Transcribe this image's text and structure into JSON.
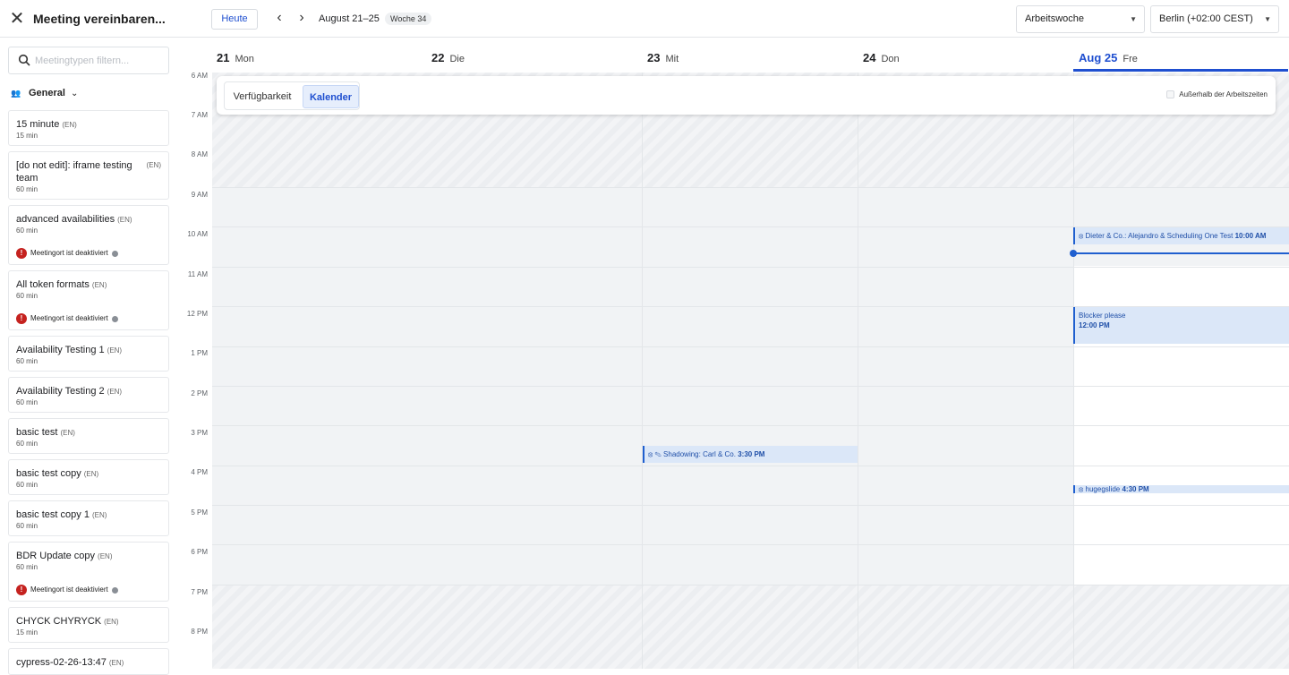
{
  "header": {
    "title": "Meeting vereinbaren...",
    "today_label": "Heute",
    "range_label": "August 21–25",
    "week_badge": "Woche 34",
    "view_select": "Arbeitswoche",
    "timezone_select": "Berlin (+02:00 CEST)"
  },
  "sidebar": {
    "search_placeholder": "Meetingtypen filtern...",
    "group_label": "General",
    "items": [
      {
        "name": "15 minute",
        "lang": "(EN)",
        "duration": "15 min"
      },
      {
        "name": "[do not edit]: iframe testing team",
        "lang": "(EN)",
        "duration": "60 min"
      },
      {
        "name": "advanced availabilities",
        "lang": "(EN)",
        "duration": "60 min",
        "warning": "Meetingort ist deaktiviert"
      },
      {
        "name": "All token formats",
        "lang": "(EN)",
        "duration": "60 min",
        "warning": "Meetingort ist deaktiviert"
      },
      {
        "name": "Availability Testing 1",
        "lang": "(EN)",
        "duration": "60 min"
      },
      {
        "name": "Availability Testing 2",
        "lang": "(EN)",
        "duration": "60 min"
      },
      {
        "name": "basic test",
        "lang": "(EN)",
        "duration": "60 min"
      },
      {
        "name": "basic test copy",
        "lang": "(EN)",
        "duration": "60 min"
      },
      {
        "name": "basic test copy 1",
        "lang": "(EN)",
        "duration": "60 min"
      },
      {
        "name": "BDR Update copy",
        "lang": "(EN)",
        "duration": "60 min",
        "warning": "Meetingort ist deaktiviert"
      },
      {
        "name": "CHYCK CHYRYCK",
        "lang": "(EN)",
        "duration": "15 min"
      },
      {
        "name": "cypress-02-26-13:47",
        "lang": "(EN)",
        "duration": ""
      }
    ]
  },
  "days": [
    {
      "num": "21",
      "name": "Mon"
    },
    {
      "num": "22",
      "name": "Die"
    },
    {
      "num": "23",
      "name": "Mit"
    },
    {
      "num": "24",
      "name": "Don"
    },
    {
      "num": "Aug 25",
      "name": "Fre"
    }
  ],
  "times": [
    "6 AM",
    "7 AM",
    "8 AM",
    "9 AM",
    "10 AM",
    "11 AM",
    "12 PM",
    "1 PM",
    "2 PM",
    "3 PM",
    "4 PM",
    "5 PM",
    "6 PM",
    "7 PM",
    "8 PM"
  ],
  "toggle": {
    "availability": "Verfügbarkeit",
    "calendar": "Kalender",
    "outside_hours": "Außerhalb der Arbeitszeiten"
  },
  "events": [
    {
      "title": "Dieter & Co.: Alejandro & Scheduling One Test",
      "time": "10:00 AM"
    },
    {
      "title": "Blocker please",
      "time": "12:00 PM"
    },
    {
      "title": "Shadowing: Carl & Co.",
      "time": "3:30 PM"
    },
    {
      "title": "hugegslide",
      "time": "4:30 PM"
    }
  ],
  "colors": {
    "accent": "#1f4fd0",
    "event_bg": "#dbe7f8",
    "warning": "#c5221f"
  }
}
